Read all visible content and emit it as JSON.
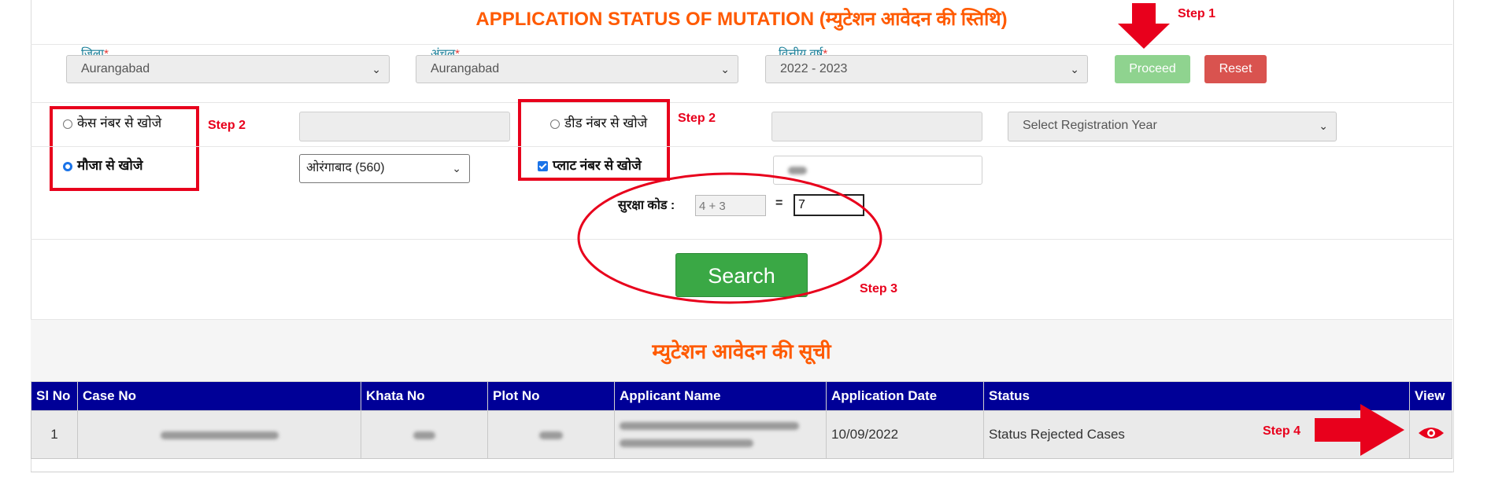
{
  "header": {
    "title": "APPLICATION STATUS OF MUTATION (म्युटेशन आवेदन की स्तिथि)"
  },
  "filters": {
    "district": {
      "label": "जिला",
      "value": "Aurangabad"
    },
    "circle": {
      "label": "अंचल",
      "value": "Aurangabad"
    },
    "fin_year": {
      "label": "वित्तीय वर्ष",
      "value": "2022 - 2023"
    },
    "required_mark": "*",
    "proceed_label": "Proceed",
    "reset_label": "Reset"
  },
  "search_options": {
    "case_no": "केस नंबर से खोजे",
    "mauza": "मौजा से खोजे",
    "deed_no": "डीड नंबर से खोजे",
    "plot_no": "प्लाट नंबर से खोजे",
    "mauza_value": "ओरंगाबाद (560)",
    "registration_year_placeholder": "Select Registration Year"
  },
  "captcha": {
    "label": "सुरक्षा कोड :",
    "question": "4 + 3",
    "equals": "=",
    "answer": "7"
  },
  "search_label": "Search",
  "steps": {
    "step1": "Step 1",
    "step2a": "Step 2",
    "step2b": "Step 2",
    "step3": "Step 3",
    "step4": "Step 4"
  },
  "results": {
    "title": "म्युटेशन आवेदन की सूची",
    "columns": [
      "Sl No",
      "Case No",
      "Khata No",
      "Plot No",
      "Applicant Name",
      "Application Date",
      "Status",
      "View"
    ],
    "rows": [
      {
        "sl": "1",
        "application_date": "10/09/2022",
        "status": "Status Rejected Cases"
      }
    ]
  },
  "colors": {
    "accent_orange": "#ff5a00",
    "header_blue": "#000097",
    "annotation_red": "#e8001c",
    "search_green": "#3aa845"
  },
  "icons": {
    "view": "eye-icon",
    "arrow": "red-arrow-icon"
  }
}
